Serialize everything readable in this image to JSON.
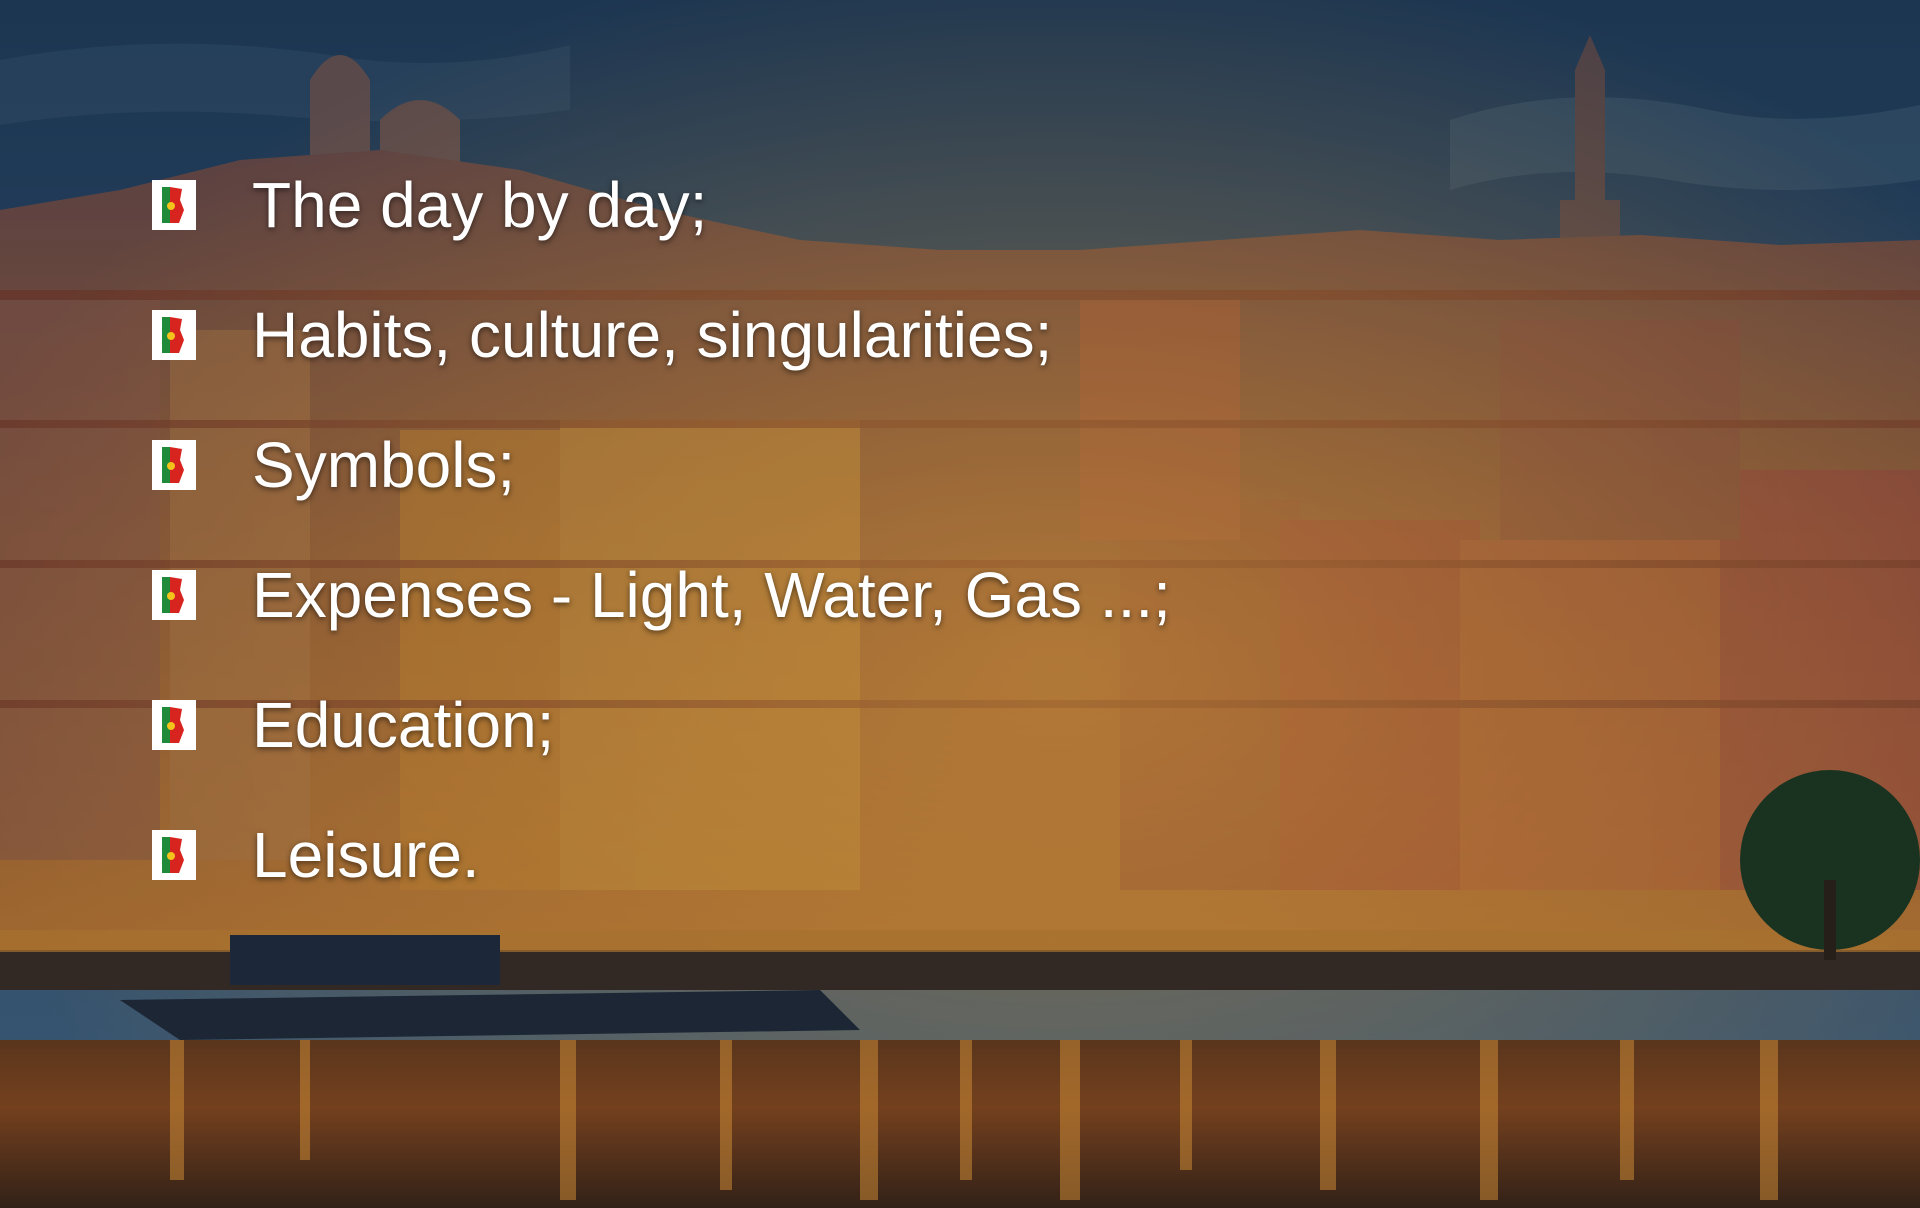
{
  "bullets": [
    "The day by day;",
    "Habits, culture, singularities;",
    "Symbols;",
    "Expenses - Light, Water, Gas ...;",
    "Education;",
    "Leisure."
  ],
  "colors": {
    "text": "#ffffff",
    "sky_top": "#1f3d5c",
    "sky_horizon": "#3b5d7e",
    "river_glow": "#e08a2a",
    "flag_green": "#1e8a3a",
    "flag_red": "#d8241f",
    "flag_yellow": "#f3c21b"
  },
  "icons": {
    "bullet": "portugal-flag-map-icon"
  }
}
